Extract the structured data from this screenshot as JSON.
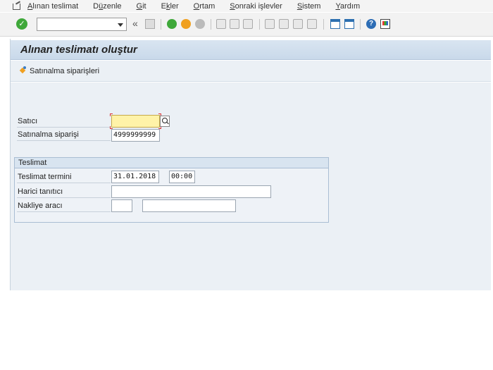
{
  "menu": {
    "items": [
      {
        "pre": "",
        "ul": "A",
        "post": "lınan teslimat"
      },
      {
        "pre": "D",
        "ul": "ü",
        "post": "zenle"
      },
      {
        "pre": "",
        "ul": "G",
        "post": "it"
      },
      {
        "pre": "E",
        "ul": "k",
        "post": "ler"
      },
      {
        "pre": "",
        "ul": "O",
        "post": "rtam"
      },
      {
        "pre": "",
        "ul": "S",
        "post": "onraki işlevler"
      },
      {
        "pre": "",
        "ul": "S",
        "post": "istem"
      },
      {
        "pre": "",
        "ul": "Y",
        "post": "ardım"
      }
    ]
  },
  "toolbar": {
    "ok_glyph": "✓",
    "command_value": "",
    "chevron": "«",
    "help_glyph": "?"
  },
  "page": {
    "title": "Alınan teslimatı oluştur",
    "po_button_label": "Satınalma siparişleri"
  },
  "form": {
    "satici_label": "Satıcı",
    "satici_value": "",
    "po_label": "Satınalma siparişi",
    "po_value": "4999999999"
  },
  "teslimat": {
    "title": "Teslimat",
    "date_label": "Teslimat termini",
    "date_value": "31.01.2018",
    "time_value": "00:00",
    "ext_id_label": "Harici tanıtıcı",
    "ext_id_value": "",
    "vehicle_label": "Nakliye aracı",
    "vehicle_value_1": "",
    "vehicle_value_2": ""
  }
}
